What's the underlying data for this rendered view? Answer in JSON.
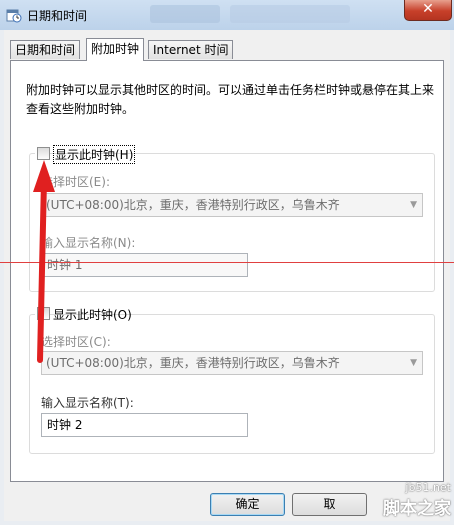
{
  "window": {
    "title": "日期和时间",
    "close_label": "✕"
  },
  "tabs": [
    {
      "label": "日期和时间"
    },
    {
      "label": "附加时钟"
    },
    {
      "label": "Internet 时间"
    }
  ],
  "active_tab": "附加时钟",
  "description": "附加时钟可以显示其他时区的时间。可以通过单击任务栏时钟或悬停在其上来查看这些附加时钟。",
  "clock1": {
    "show_label": "显示此时钟(H)",
    "checked": false,
    "timezone_label": "选择时区(E):",
    "timezone_value": "(UTC+08:00)北京，重庆，香港特别行政区，乌鲁木齐",
    "name_label": "输入显示名称(N):",
    "name_value": "时钟 1"
  },
  "clock2": {
    "show_label": "显示此时钟(O)",
    "checked": false,
    "timezone_label": "选择时区(C):",
    "timezone_value": "(UTC+08:00)北京，重庆，香港特别行政区，乌鲁木齐",
    "name_label": "输入显示名称(T):",
    "name_value": "时钟 2"
  },
  "buttons": {
    "ok": "确定",
    "cancel": "取"
  },
  "watermark": {
    "site": "jb51.net",
    "name": "脚本之家"
  },
  "colors": {
    "annotation_red": "#e02020",
    "titlebar": "#bcd2ea",
    "close_button": "#c7402a"
  }
}
